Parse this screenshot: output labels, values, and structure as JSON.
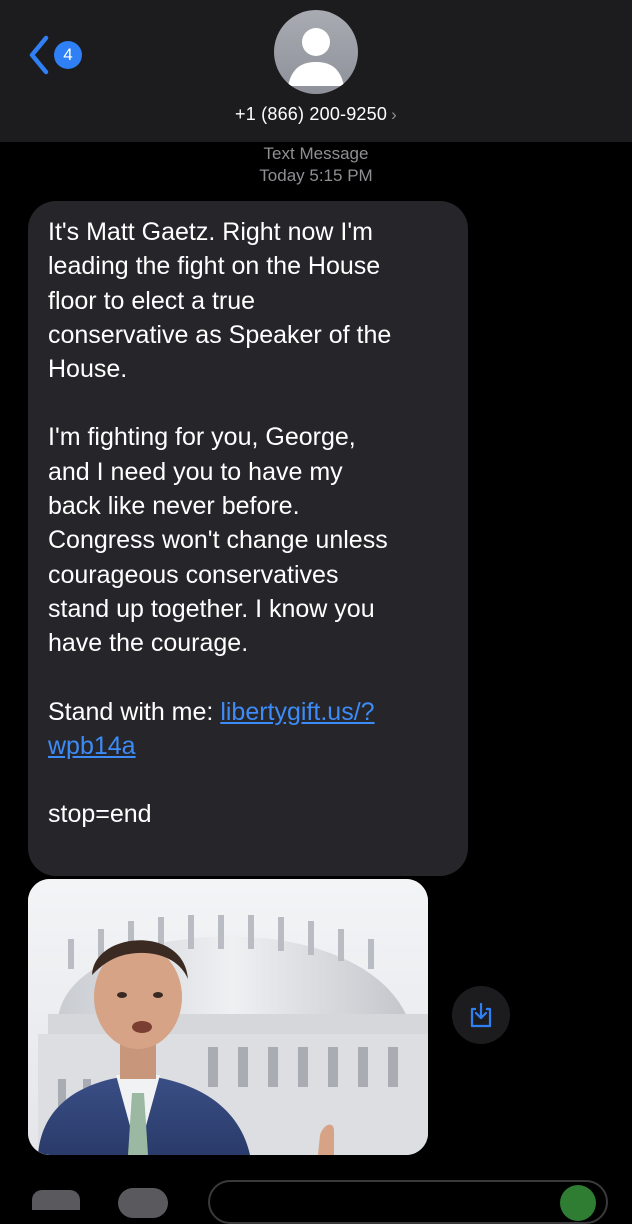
{
  "header": {
    "back_badge": "4",
    "contact_number": "+1 (866) 200-9250",
    "contact_chevron": "›"
  },
  "timestamp": {
    "service": "Text Message",
    "time": "Today 5:15 PM"
  },
  "message": {
    "para1": "It's Matt Gaetz. Right now I'm\nleading the fight on the House\nfloor to elect a true\nconservative as Speaker of the\nHouse.",
    "para2": "I'm fighting for you, George,\nand I need you to have my\nback like never before.\nCongress won't change unless\ncourageous conservatives\nstand up together. I know you\nhave the courage.",
    "cta_prefix": "Stand with me: ",
    "link_line1": "libertygift.us/?",
    "link_line2": "wpb14a",
    "stop": "stop=end"
  },
  "icons": {
    "back": "chevron-left-icon",
    "avatar": "person-icon",
    "save": "download-icon"
  },
  "colors": {
    "accent": "#2f7ff5",
    "link": "#3d8bf6",
    "bubble": "#26262a",
    "header": "#1c1c1e"
  }
}
